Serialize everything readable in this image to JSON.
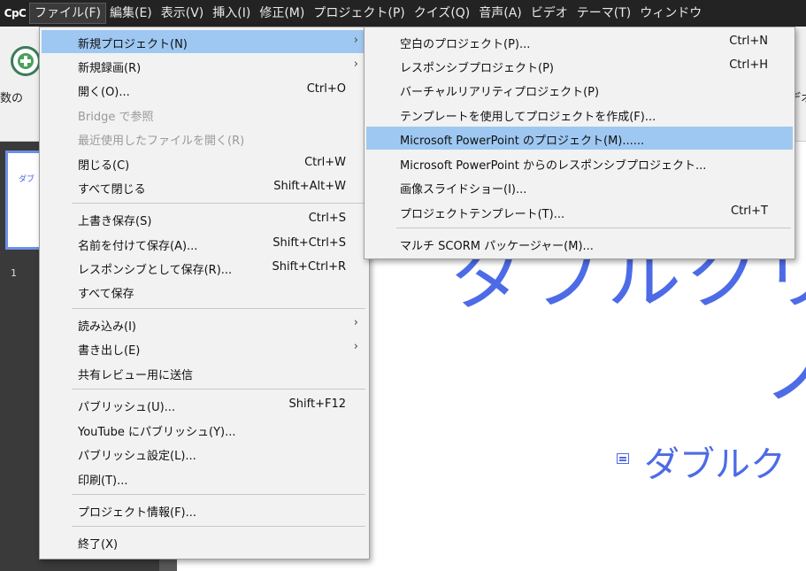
{
  "app": {
    "logo": "CpC"
  },
  "menubar": [
    {
      "label": "ファイル(F)",
      "active": true
    },
    {
      "label": "編集(E)"
    },
    {
      "label": "表示(V)"
    },
    {
      "label": "挿入(I)"
    },
    {
      "label": "修正(M)"
    },
    {
      "label": "プロジェクト(P)"
    },
    {
      "label": "クイズ(Q)"
    },
    {
      "label": "音声(A)"
    },
    {
      "label": "ビデオ"
    },
    {
      "label": "テーマ(T)"
    },
    {
      "label": "ウィンドウ"
    }
  ],
  "toolbar": {
    "left_label": "数の",
    "right_label": "デオ"
  },
  "filmstrip": {
    "thumb_text": "ダブ",
    "slide_number": "1"
  },
  "canvas": {
    "title_line1": "ダブルクリ",
    "title_line2": "ノ",
    "subtitle": "ダブルク"
  },
  "file_menu": {
    "items": [
      {
        "label": "新規プロジェクト(N)",
        "submenu": true,
        "highlight": true
      },
      {
        "label": "新規録画(R)",
        "submenu": true
      },
      {
        "label": "開く(O)...",
        "shortcut": "Ctrl+O"
      },
      {
        "label": "Bridge で参照",
        "disabled": true
      },
      {
        "label": "最近使用したファイルを開く(R)",
        "disabled": true
      },
      {
        "label": "閉じる(C)",
        "shortcut": "Ctrl+W"
      },
      {
        "label": "すべて閉じる",
        "shortcut": "Shift+Alt+W"
      },
      {
        "label": "上書き保存(S)",
        "shortcut": "Ctrl+S"
      },
      {
        "label": "名前を付けて保存(A)...",
        "shortcut": "Shift+Ctrl+S"
      },
      {
        "label": "レスポンシブとして保存(R)...",
        "shortcut": "Shift+Ctrl+R"
      },
      {
        "label": "すべて保存"
      },
      {
        "label": "読み込み(I)",
        "submenu": true
      },
      {
        "label": "書き出し(E)",
        "submenu": true
      },
      {
        "label": "共有レビュー用に送信"
      },
      {
        "label": "パブリッシュ(U)...",
        "shortcut": "Shift+F12"
      },
      {
        "label": "YouTube にパブリッシュ(Y)..."
      },
      {
        "label": "パブリッシュ設定(L)..."
      },
      {
        "label": "印刷(T)..."
      },
      {
        "label": "プロジェクト情報(F)..."
      },
      {
        "label": "終了(X)"
      }
    ]
  },
  "new_project_submenu": {
    "items": [
      {
        "label": "空白のプロジェクト(P)...",
        "shortcut": "Ctrl+N"
      },
      {
        "label": "レスポンシブプロジェクト(P)",
        "shortcut": "Ctrl+H"
      },
      {
        "label": "バーチャルリアリティプロジェクト(P)"
      },
      {
        "label": "テンプレートを使用してプロジェクトを作成(F)..."
      },
      {
        "label": "Microsoft PowerPoint のプロジェクト(M)......",
        "highlight": true
      },
      {
        "label": "Microsoft PowerPoint からのレスポンシブプロジェクト..."
      },
      {
        "label": "画像スライドショー(I)..."
      },
      {
        "label": "プロジェクトテンプレート(T)...",
        "shortcut": "Ctrl+T"
      },
      {
        "label": "マルチ SCORM パッケージャー(M)..."
      }
    ]
  },
  "colors": {
    "menubar_bg": "#232323",
    "highlight": "#9ec8f2",
    "accent_text": "#4d6be6"
  },
  "submenu_arrow_glyph": "›"
}
